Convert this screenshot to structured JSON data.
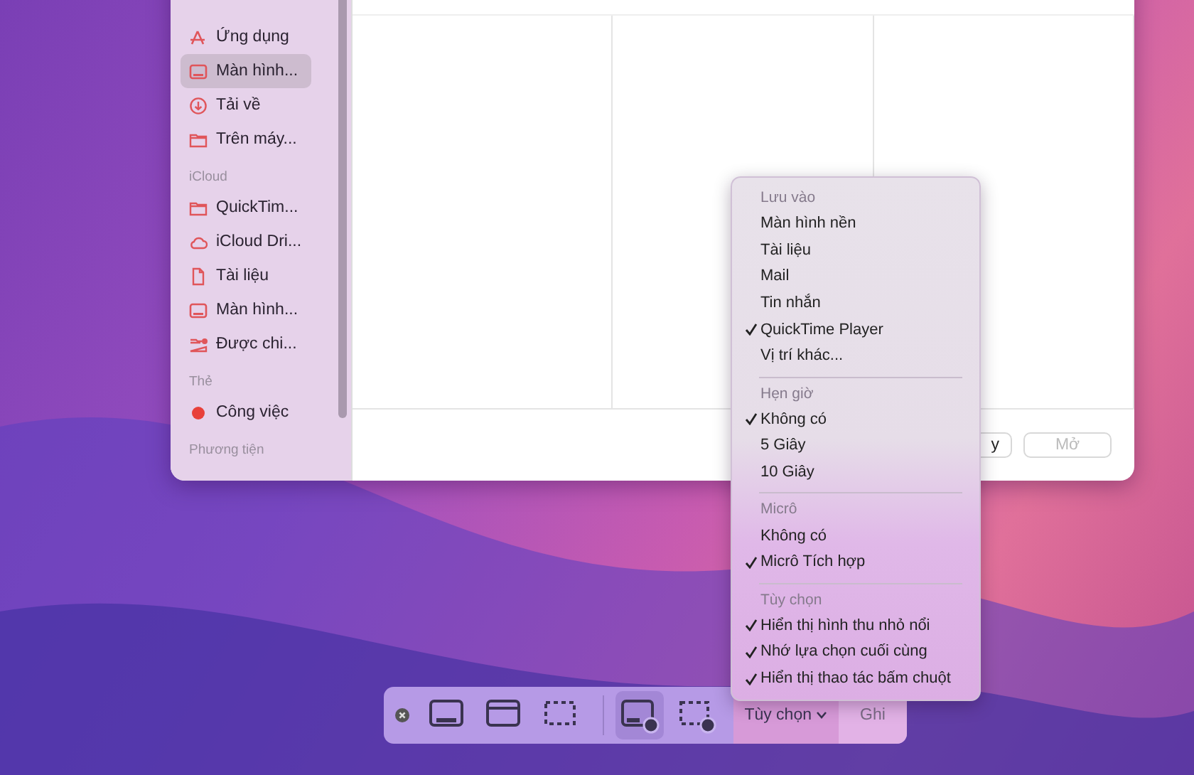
{
  "dialog": {
    "sidebar": {
      "sections": [
        {
          "items": [
            {
              "label": "Ứng dụng",
              "kind": "apps",
              "selected": false
            },
            {
              "label": "Màn hình...",
              "kind": "display",
              "selected": true
            },
            {
              "label": "Tải về",
              "kind": "download",
              "selected": false
            },
            {
              "label": "Trên máy...",
              "kind": "folder",
              "selected": false
            }
          ]
        },
        {
          "header": "iCloud",
          "items": [
            {
              "label": "QuickTim...",
              "kind": "folder",
              "selected": false
            },
            {
              "label": "iCloud Dri...",
              "kind": "cloud",
              "selected": false
            },
            {
              "label": "Tài liệu",
              "kind": "doc",
              "selected": false
            },
            {
              "label": "Màn hình...",
              "kind": "display",
              "selected": false
            },
            {
              "label": "Được chi...",
              "kind": "shared",
              "selected": false
            }
          ]
        },
        {
          "header": "Thẻ",
          "items": [
            {
              "label": "Công việc",
              "kind": "tag",
              "color": "#e8403a",
              "selected": false
            }
          ]
        },
        {
          "header": "Phương tiện"
        }
      ]
    },
    "buttons": [
      {
        "label": "y",
        "disabled": false
      },
      {
        "label": "Mở",
        "disabled": true
      }
    ]
  },
  "menu": {
    "sections": [
      {
        "header": "Lưu vào",
        "items": [
          {
            "label": "Màn hình nền",
            "checked": false
          },
          {
            "label": "Tài liệu",
            "checked": false
          },
          {
            "label": "Mail",
            "checked": false
          },
          {
            "label": "Tin nhắn",
            "checked": false
          },
          {
            "label": "QuickTime Player",
            "checked": true
          },
          {
            "label": "Vị trí khác...",
            "checked": false
          }
        ]
      },
      {
        "header": "Hẹn giờ",
        "items": [
          {
            "label": "Không có",
            "checked": true
          },
          {
            "label": "5 Giây",
            "checked": false
          },
          {
            "label": "10 Giây",
            "checked": false
          }
        ]
      },
      {
        "header": "Micrô",
        "items": [
          {
            "label": "Không có",
            "checked": false
          },
          {
            "label": "Micrô Tích hợp",
            "checked": true
          }
        ]
      },
      {
        "header": "Tùy chọn",
        "items": [
          {
            "label": "Hiển thị hình thu nhỏ nổi",
            "checked": true
          },
          {
            "label": "Nhớ lựa chọn cuối cùng",
            "checked": true
          },
          {
            "label": "Hiển thị thao tác bấm chuột",
            "checked": true
          }
        ]
      }
    ]
  },
  "toolbar": {
    "tools": [
      {
        "kind": "screen",
        "selected": false
      },
      {
        "kind": "window",
        "selected": false
      },
      {
        "kind": "selection",
        "selected": false
      },
      {
        "kind": "record-screen",
        "selected": true
      },
      {
        "kind": "record-selection",
        "selected": false
      }
    ],
    "options_label": "Tùy chọn",
    "options_open": true,
    "record_label": "Ghi"
  }
}
